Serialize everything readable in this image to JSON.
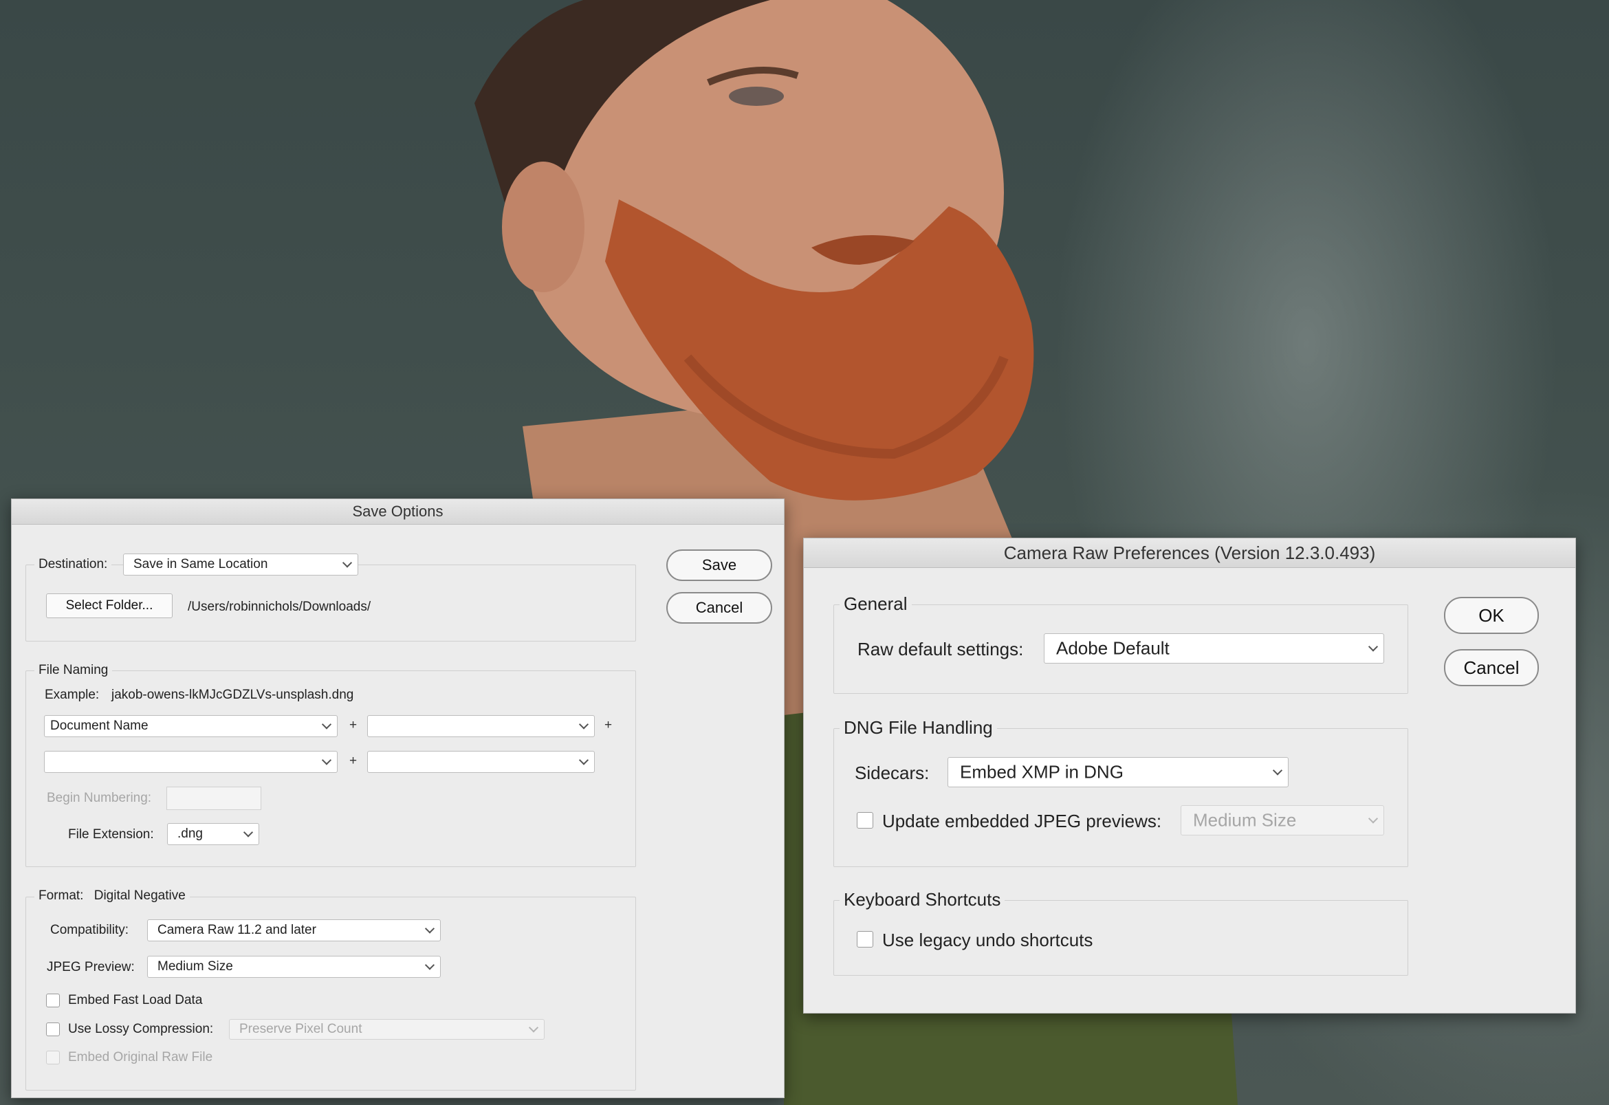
{
  "save_options": {
    "title": "Save Options",
    "destination": {
      "label": "Destination:",
      "selected": "Save in Same Location",
      "select_folder_button": "Select Folder...",
      "path": "/Users/robinnichols/Downloads/"
    },
    "file_naming": {
      "legend": "File Naming",
      "example_label": "Example:",
      "example_value": "jakob-owens-lkMJcGDZLVs-unsplash.dng",
      "row1_field1": "Document Name",
      "row1_field2": "",
      "row2_field1": "",
      "row2_field2": "",
      "plus": "+",
      "begin_numbering_label": "Begin Numbering:",
      "begin_numbering_value": "",
      "file_extension_label": "File Extension:",
      "file_extension_value": ".dng"
    },
    "format": {
      "legend_label": "Format:",
      "legend_value": "Digital Negative",
      "compatibility_label": "Compatibility:",
      "compatibility_value": "Camera Raw 11.2 and later",
      "jpeg_preview_label": "JPEG Preview:",
      "jpeg_preview_value": "Medium Size",
      "embed_fast_load_label": "Embed Fast Load Data",
      "embed_fast_load_checked": false,
      "lossy_label": "Use Lossy Compression:",
      "lossy_checked": false,
      "lossy_value": "Preserve Pixel Count",
      "embed_raw_label": "Embed Original Raw File",
      "embed_raw_checked": false
    },
    "buttons": {
      "save": "Save",
      "cancel": "Cancel"
    }
  },
  "camera_raw_prefs": {
    "title": "Camera Raw Preferences  (Version 12.3.0.493)",
    "general": {
      "legend": "General",
      "raw_default_label": "Raw default settings:",
      "raw_default_value": "Adobe Default"
    },
    "dng": {
      "legend": "DNG File Handling",
      "sidecars_label": "Sidecars:",
      "sidecars_value": "Embed XMP in DNG",
      "update_jpeg_label": "Update embedded JPEG previews:",
      "update_jpeg_checked": false,
      "update_jpeg_value": "Medium Size"
    },
    "keyboard": {
      "legend": "Keyboard Shortcuts",
      "legacy_undo_label": "Use legacy undo shortcuts",
      "legacy_undo_checked": false
    },
    "buttons": {
      "ok": "OK",
      "cancel": "Cancel"
    }
  },
  "colors": {
    "dialog_bg": "#ececec",
    "background_photo_tone": "#3d4a4b",
    "beard": "#b2552e",
    "shirt": "#4b5a2e"
  }
}
